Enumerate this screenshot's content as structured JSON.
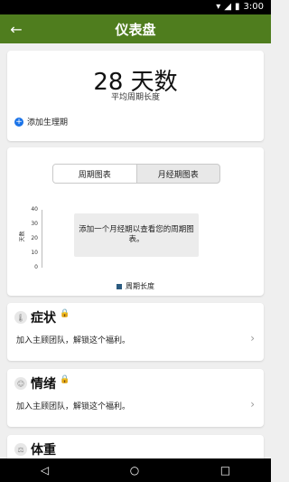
{
  "status_bar": {
    "time": "3:00",
    "wifi_icon": "wifi-icon",
    "signal_icon": "signal-icon",
    "battery_icon": "battery-icon"
  },
  "app_bar": {
    "title": "仪表盘",
    "back_icon": "back-arrow-icon"
  },
  "summary": {
    "cycle_value": "28 天数",
    "cycle_caption": "平均周期长度",
    "add_period_label": "添加生理期",
    "add_icon": "plus-circle-icon"
  },
  "chart_tabs": [
    "周期图表",
    "月经期图表"
  ],
  "chart_data": {
    "type": "bar",
    "title": "",
    "ylabel": "天数",
    "xlabel": "",
    "ylim": [
      0,
      40
    ],
    "y_ticks": [
      "40",
      "30",
      "20",
      "10",
      "0"
    ],
    "categories": [],
    "series": [
      {
        "name": "周期长度",
        "values": []
      }
    ],
    "colors": {
      "series": "#2b5b80"
    },
    "legend_position": "bottom",
    "grid": false
  },
  "chart_empty_message": "添加一个月经期以查看您的周期图表。",
  "features": [
    {
      "title": "症状",
      "description": "加入主顾团队，解锁这个福利。",
      "icon": "thermometer-icon",
      "locked_icon": "lock-icon"
    },
    {
      "title": "情绪",
      "description": "加入主顾团队，解锁这个福利。",
      "icon": "mood-icon",
      "locked_icon": "lock-icon"
    },
    {
      "title": "体重",
      "description": "",
      "icon": "scale-icon",
      "locked_icon": ""
    }
  ],
  "nav_bar": {
    "back": "back-icon",
    "home": "home-icon",
    "recents": "recents-icon"
  },
  "colors": {
    "accent": "#4f7d1e",
    "lock": "#f0b400",
    "series": "#2b5b80"
  }
}
